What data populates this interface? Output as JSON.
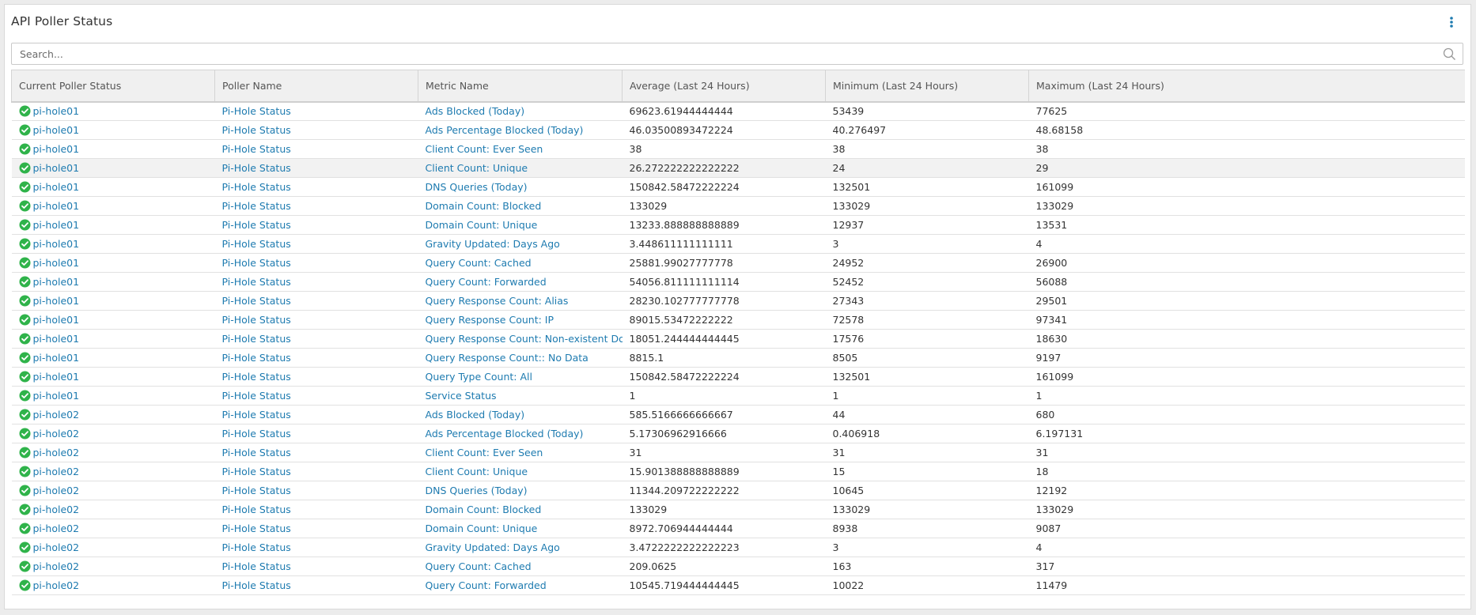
{
  "panel": {
    "title": "API Poller Status",
    "menu_icon": "vertical-ellipsis-icon"
  },
  "search": {
    "placeholder": "Search...",
    "value": "",
    "icon": "search-icon"
  },
  "colors": {
    "link": "#1e7bb0",
    "status_ok": "#2fb34a",
    "header_bg": "#f0f0f0"
  },
  "table": {
    "columns": [
      "Current Poller Status",
      "Poller Name",
      "Metric Name",
      "Average (Last 24 Hours)",
      "Minimum (Last 24 Hours)",
      "Maximum (Last 24 Hours)"
    ],
    "rows": [
      {
        "status_icon": "check-circle-icon",
        "node": "pi-hole01",
        "poller": "Pi-Hole Status",
        "metric": "Ads Blocked (Today)",
        "avg": "69623.61944444444",
        "min": "53439",
        "max": "77625"
      },
      {
        "status_icon": "check-circle-icon",
        "node": "pi-hole01",
        "poller": "Pi-Hole Status",
        "metric": "Ads Percentage Blocked (Today)",
        "avg": "46.03500893472224",
        "min": "40.276497",
        "max": "48.68158"
      },
      {
        "status_icon": "check-circle-icon",
        "node": "pi-hole01",
        "poller": "Pi-Hole Status",
        "metric": "Client Count: Ever Seen",
        "avg": "38",
        "min": "38",
        "max": "38"
      },
      {
        "status_icon": "check-circle-icon",
        "node": "pi-hole01",
        "poller": "Pi-Hole Status",
        "metric": "Client Count: Unique",
        "avg": "26.272222222222222",
        "min": "24",
        "max": "29"
      },
      {
        "status_icon": "check-circle-icon",
        "node": "pi-hole01",
        "poller": "Pi-Hole Status",
        "metric": "DNS Queries (Today)",
        "avg": "150842.58472222224",
        "min": "132501",
        "max": "161099"
      },
      {
        "status_icon": "check-circle-icon",
        "node": "pi-hole01",
        "poller": "Pi-Hole Status",
        "metric": "Domain Count: Blocked",
        "avg": "133029",
        "min": "133029",
        "max": "133029"
      },
      {
        "status_icon": "check-circle-icon",
        "node": "pi-hole01",
        "poller": "Pi-Hole Status",
        "metric": "Domain Count: Unique",
        "avg": "13233.888888888889",
        "min": "12937",
        "max": "13531"
      },
      {
        "status_icon": "check-circle-icon",
        "node": "pi-hole01",
        "poller": "Pi-Hole Status",
        "metric": "Gravity Updated: Days Ago",
        "avg": "3.448611111111111",
        "min": "3",
        "max": "4"
      },
      {
        "status_icon": "check-circle-icon",
        "node": "pi-hole01",
        "poller": "Pi-Hole Status",
        "metric": "Query Count: Cached",
        "avg": "25881.99027777778",
        "min": "24952",
        "max": "26900"
      },
      {
        "status_icon": "check-circle-icon",
        "node": "pi-hole01",
        "poller": "Pi-Hole Status",
        "metric": "Query Count: Forwarded",
        "avg": "54056.811111111114",
        "min": "52452",
        "max": "56088"
      },
      {
        "status_icon": "check-circle-icon",
        "node": "pi-hole01",
        "poller": "Pi-Hole Status",
        "metric": "Query Response Count: Alias",
        "avg": "28230.102777777778",
        "min": "27343",
        "max": "29501"
      },
      {
        "status_icon": "check-circle-icon",
        "node": "pi-hole01",
        "poller": "Pi-Hole Status",
        "metric": "Query Response Count: IP",
        "avg": "89015.53472222222",
        "min": "72578",
        "max": "97341"
      },
      {
        "status_icon": "check-circle-icon",
        "node": "pi-hole01",
        "poller": "Pi-Hole Status",
        "metric": "Query Response Count: Non-existent Domain",
        "avg": "18051.244444444445",
        "min": "17576",
        "max": "18630"
      },
      {
        "status_icon": "check-circle-icon",
        "node": "pi-hole01",
        "poller": "Pi-Hole Status",
        "metric": "Query Response Count:: No Data",
        "avg": "8815.1",
        "min": "8505",
        "max": "9197"
      },
      {
        "status_icon": "check-circle-icon",
        "node": "pi-hole01",
        "poller": "Pi-Hole Status",
        "metric": "Query Type Count: All",
        "avg": "150842.58472222224",
        "min": "132501",
        "max": "161099"
      },
      {
        "status_icon": "check-circle-icon",
        "node": "pi-hole01",
        "poller": "Pi-Hole Status",
        "metric": "Service Status",
        "avg": "1",
        "min": "1",
        "max": "1"
      },
      {
        "status_icon": "check-circle-icon",
        "node": "pi-hole02",
        "poller": "Pi-Hole Status",
        "metric": "Ads Blocked (Today)",
        "avg": "585.5166666666667",
        "min": "44",
        "max": "680"
      },
      {
        "status_icon": "check-circle-icon",
        "node": "pi-hole02",
        "poller": "Pi-Hole Status",
        "metric": "Ads Percentage Blocked (Today)",
        "avg": "5.17306962916666",
        "min": "0.406918",
        "max": "6.197131"
      },
      {
        "status_icon": "check-circle-icon",
        "node": "pi-hole02",
        "poller": "Pi-Hole Status",
        "metric": "Client Count: Ever Seen",
        "avg": "31",
        "min": "31",
        "max": "31"
      },
      {
        "status_icon": "check-circle-icon",
        "node": "pi-hole02",
        "poller": "Pi-Hole Status",
        "metric": "Client Count: Unique",
        "avg": "15.901388888888889",
        "min": "15",
        "max": "18"
      },
      {
        "status_icon": "check-circle-icon",
        "node": "pi-hole02",
        "poller": "Pi-Hole Status",
        "metric": "DNS Queries (Today)",
        "avg": "11344.209722222222",
        "min": "10645",
        "max": "12192"
      },
      {
        "status_icon": "check-circle-icon",
        "node": "pi-hole02",
        "poller": "Pi-Hole Status",
        "metric": "Domain Count: Blocked",
        "avg": "133029",
        "min": "133029",
        "max": "133029"
      },
      {
        "status_icon": "check-circle-icon",
        "node": "pi-hole02",
        "poller": "Pi-Hole Status",
        "metric": "Domain Count: Unique",
        "avg": "8972.706944444444",
        "min": "8938",
        "max": "9087"
      },
      {
        "status_icon": "check-circle-icon",
        "node": "pi-hole02",
        "poller": "Pi-Hole Status",
        "metric": "Gravity Updated: Days Ago",
        "avg": "3.4722222222222223",
        "min": "3",
        "max": "4"
      },
      {
        "status_icon": "check-circle-icon",
        "node": "pi-hole02",
        "poller": "Pi-Hole Status",
        "metric": "Query Count: Cached",
        "avg": "209.0625",
        "min": "163",
        "max": "317"
      },
      {
        "status_icon": "check-circle-icon",
        "node": "pi-hole02",
        "poller": "Pi-Hole Status",
        "metric": "Query Count: Forwarded",
        "avg": "10545.719444444445",
        "min": "10022",
        "max": "11479"
      }
    ]
  }
}
